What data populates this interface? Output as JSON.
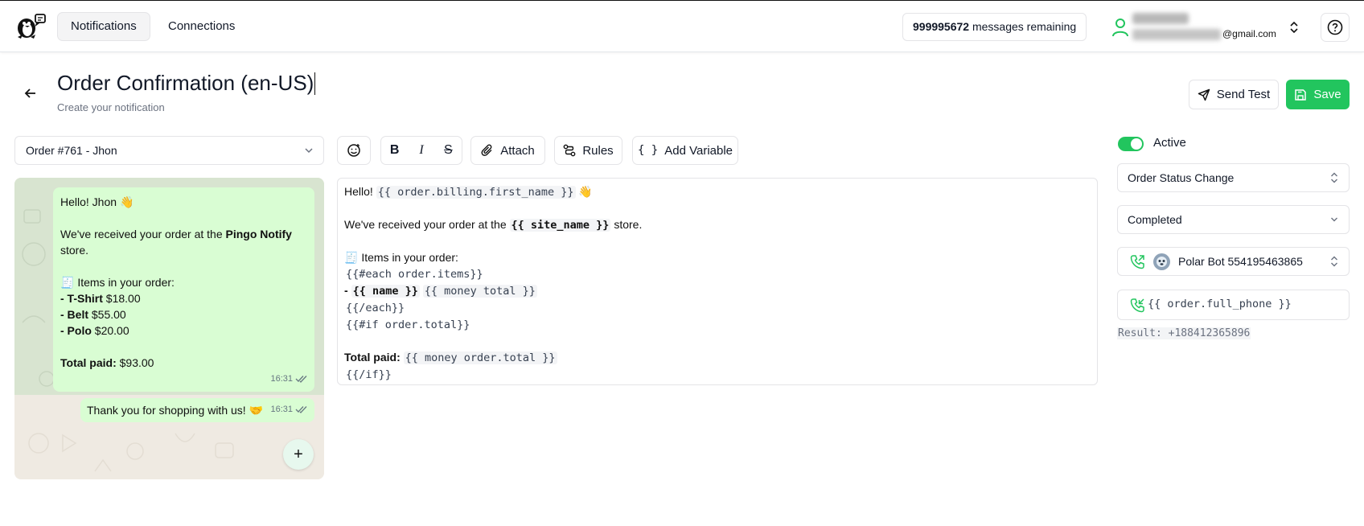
{
  "nav": {
    "tabs": [
      {
        "label": "Notifications"
      },
      {
        "label": "Connections"
      }
    ]
  },
  "usage": {
    "count": "999995672",
    "label": "messages remaining"
  },
  "account": {
    "email_suffix": "@gmail.com"
  },
  "header": {
    "title": "Order Confirmation (en-US)",
    "subtitle": "Create your notification",
    "send_test_label": "Send Test",
    "save_label": "Save"
  },
  "order_select": {
    "value": "Order #761 - Jhon"
  },
  "toolbar": {
    "attach_label": "Attach",
    "rules_label": "Rules",
    "add_variable_label": "Add Variable",
    "bold": "B",
    "italic": "I",
    "strike": "S",
    "braces": "{ }"
  },
  "preview": {
    "greeting": "Hello! Jhon",
    "wave": "👋",
    "received_prefix": "We've received your order at the ",
    "store_name": "Pingo Notify",
    "received_suffix": "store.",
    "items_emoji": "🧾",
    "items_heading": "Items in your order:",
    "items": [
      {
        "name": "- T-Shirt",
        "price": " $18.00"
      },
      {
        "name": "- Belt",
        "price": " $55.00"
      },
      {
        "name": "- Polo",
        "price": " $20.00"
      }
    ],
    "total_label": "Total paid:",
    "total_value": " $93.00",
    "time": "16:31",
    "thanks": "Thank you for shopping with us! 🤝",
    "thanks_time": "16:31",
    "fab": "+"
  },
  "editor": {
    "hello": "Hello! ",
    "first_name_var": "{{ order.billing.first_name }}",
    "wave": " 👋",
    "received_prefix": "We've received your order at the ",
    "site_name_var": "{{ site_name }}",
    "received_suffix": " store.",
    "items_emoji": "🧾",
    "items_heading": " Items in your order:",
    "each_open": "{{#each order.items}}",
    "dash": "- ",
    "name_var": "{{ name }}",
    "money_total_var": "{{ money total }}",
    "each_close": "{{/each}}",
    "if_open": "{{#if order.total}}",
    "total_label": "Total paid: ",
    "money_order_total_var": "{{ money order.total }}",
    "if_close": "{{/if}}"
  },
  "settings": {
    "active_label": "Active",
    "active": true,
    "trigger": "Order Status Change",
    "status": "Completed",
    "bot": "Polar Bot 554195463865",
    "phone_var": "{{ order.full_phone }}",
    "result": "Result: +188412365896"
  },
  "colors": {
    "accent": "#22c55e",
    "bubble": "#d9fdd3"
  }
}
